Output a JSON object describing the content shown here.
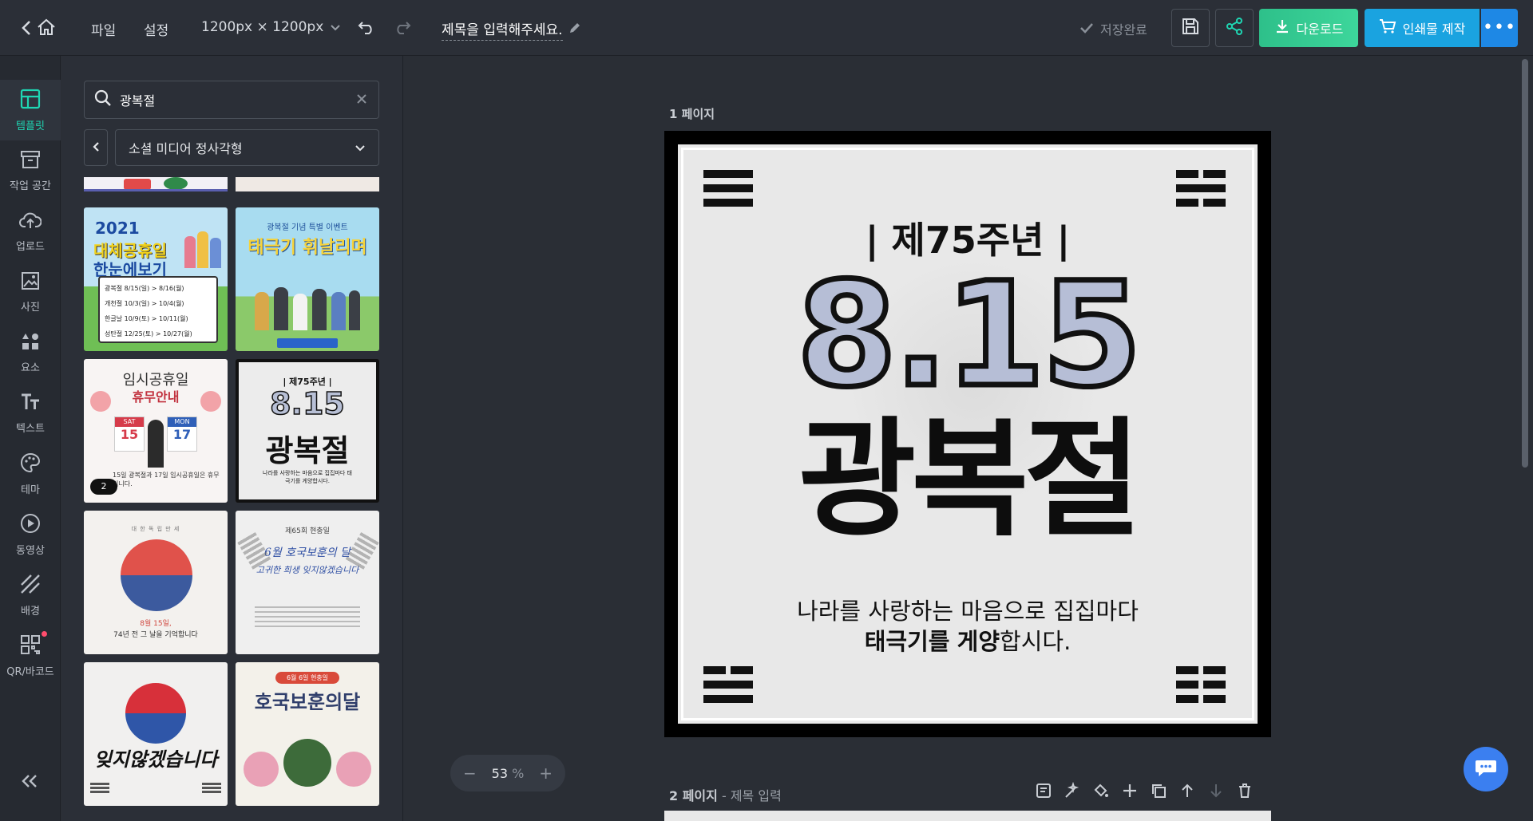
{
  "topbar": {
    "menu_file": "파일",
    "menu_settings": "설정",
    "canvas_size": "1200px × 1200px",
    "title": "제목을 입력해주세요.",
    "save_status": "저장완료",
    "download_label": "다운로드",
    "print_label": "인쇄물 제작"
  },
  "rail": {
    "items": [
      {
        "label": "템플릿"
      },
      {
        "label": "작업 공간"
      },
      {
        "label": "업로드"
      },
      {
        "label": "사진"
      },
      {
        "label": "요소"
      },
      {
        "label": "텍스트"
      },
      {
        "label": "테마"
      },
      {
        "label": "동영상"
      },
      {
        "label": "배경"
      },
      {
        "label": "QR/바코드"
      }
    ]
  },
  "panel": {
    "search_value": "광복절",
    "category": "소셜 미디어 정사각형",
    "badge_count": "2"
  },
  "thumbs": {
    "t1_line1": "2021",
    "t1_line2": "대체공휴일",
    "t1_line3": "한눈에보기",
    "t1_rows": [
      "광복절  8/15(일) > 8/16(월)",
      "개천절  10/3(일) > 10/4(월)",
      "한글날  10/9(토) > 10/11(월)",
      "성탄절  12/25(토) > 10/27(월)"
    ],
    "t2_top": "광복절 기념 특별 이벤트",
    "t2_title": "태극기 휘날리며",
    "t3_title1": "임시공휴일",
    "t3_title2": "휴무안내",
    "t3_sat": "SAT",
    "t3_mon": "MON",
    "t3_d1": "15",
    "t3_d2": "17",
    "t3_bottom": "15일 광복절과 17일 임시공휴일은 휴무입니다.",
    "t4_top": "| 제75주년 |",
    "t4_num": "8.15",
    "t4_title": "광복절",
    "t4_bottom": "나라를 사랑하는 마음으로 집집마다 태극기를 게양합시다.",
    "t5_top": "대 한 독 립 만 세",
    "t5_l1": "8월 15일,",
    "t5_l2": "74년 전 그 날을 기억합니다",
    "t6_top": "제65회 현충일",
    "t6_l1": "6월 호국보훈의 달",
    "t6_l2": "고귀한 희생 잊지않겠습니다",
    "t7_title": "잊지않겠습니다",
    "t8_top": "6월 6일 현충일",
    "t8_title": "호국보훈의달"
  },
  "canvas": {
    "page1_label": "1 페이지",
    "subtitle": "| 제75주년 |",
    "big_number": "8.15",
    "big_title": "광복절",
    "line1": "나라를 사랑하는 마음으로 집집마다",
    "line2_bold1": "태극기를",
    "line2_bold2": "게양",
    "line2_rest": "합시다.",
    "page2_label": "2 페이지",
    "page2_sub": "- 제목 입력",
    "zoom_value": "53",
    "zoom_unit": "%"
  },
  "colors": {
    "accent_teal": "#1fd6b3",
    "download_green": "#2ec08a",
    "print_blue": "#1aa3e0",
    "more_blue": "#1e88e5"
  }
}
